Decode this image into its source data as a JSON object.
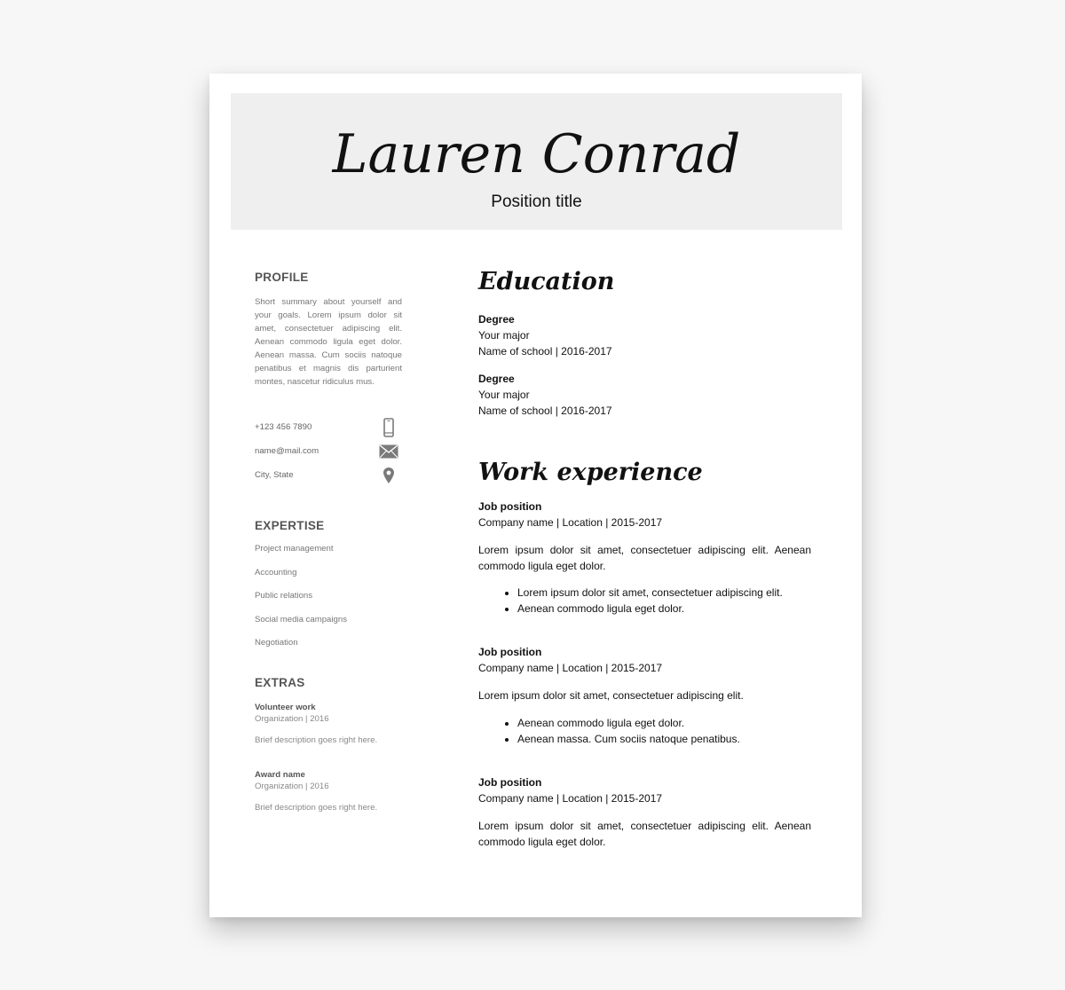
{
  "header": {
    "name": "Lauren Conrad",
    "position_title": "Position title"
  },
  "profile": {
    "title": "PROFILE",
    "text": "Short summary about yourself and your goals. Lorem ipsum dolor sit amet, consectetuer adipiscing elit. Aenean commodo ligula eget dolor. Aenean massa. Cum sociis natoque penatibus et magnis dis parturient montes, nascetur ridiculus mus."
  },
  "contact": {
    "phone": "+123 456 7890",
    "email": "name@mail.com",
    "location": "City, State",
    "icons": [
      "phone-icon",
      "envelope-icon",
      "location-pin-icon"
    ]
  },
  "expertise": {
    "title": "EXPERTISE",
    "items": [
      "Project management",
      "Accounting",
      "Public relations",
      "Social media campaigns",
      "Negotiation"
    ]
  },
  "extras": {
    "title": "EXTRAS",
    "items": [
      {
        "name": "Volunteer work",
        "org": "Organization | 2016",
        "desc": "Brief description goes right here."
      },
      {
        "name": "Award name",
        "org": "Organization | 2016",
        "desc": "Brief description goes right here."
      }
    ]
  },
  "education": {
    "title": "Education",
    "entries": [
      {
        "degree": "Degree",
        "major": "Your major",
        "school": "Name of school | 2016-2017"
      },
      {
        "degree": "Degree",
        "major": "Your major",
        "school": "Name of school | 2016-2017"
      }
    ]
  },
  "work": {
    "title": "Work experience",
    "jobs": [
      {
        "position": "Job position",
        "company": "Company name | Location | 2015-2017",
        "desc": "Lorem ipsum dolor sit amet, consectetuer adipiscing elit. Aenean commodo ligula eget dolor.",
        "bullets": [
          "Lorem ipsum dolor sit amet, consectetuer adipiscing elit.",
          "Aenean commodo ligula eget dolor."
        ]
      },
      {
        "position": "Job position",
        "company": "Company name | Location | 2015-2017",
        "desc": "Lorem ipsum dolor sit amet, consectetuer adipiscing elit.",
        "bullets": [
          "Aenean commodo ligula eget dolor.",
          "Aenean massa. Cum sociis natoque penatibus."
        ]
      },
      {
        "position": "Job position",
        "company": "Company name | Location | 2015-2017",
        "desc": "Lorem ipsum dolor sit amet, consectetuer adipiscing elit. Aenean commodo ligula eget dolor."
      }
    ]
  },
  "colors": {
    "background": "#f7f7f7",
    "paper": "#ffffff",
    "header_band": "#efefef",
    "text": "#111111",
    "muted": "#777777"
  }
}
